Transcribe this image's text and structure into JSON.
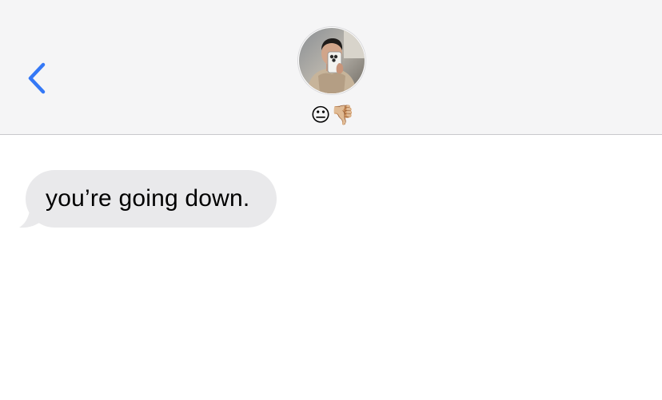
{
  "header": {
    "back_icon": "chevron-left-icon",
    "accent_color": "#3478f6",
    "contact_status": "😐👎🏼"
  },
  "conversation": {
    "messages": [
      {
        "direction": "incoming",
        "text": "you’re going down."
      }
    ],
    "incoming_bubble_color": "#e9e9eb"
  }
}
